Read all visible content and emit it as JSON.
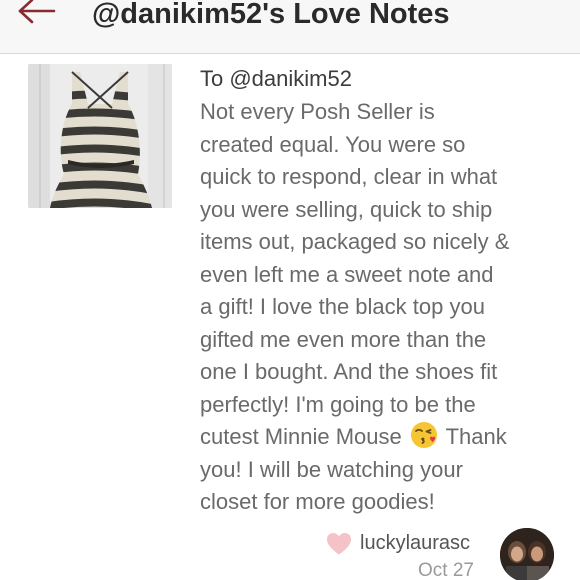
{
  "header": {
    "title": "@danikim52's Love Notes",
    "back_icon": "back-arrow-icon",
    "accent_color": "#8b2a2e"
  },
  "note": {
    "thumbnail": "striped-top-listing-photo",
    "recipient": "To @danikim52",
    "message_lines": [
      "Not every Posh Seller is",
      "created equal. You were so",
      "quick to respond, clear in what",
      "you were selling, quick to ship",
      "items out, packaged so nicely &",
      "even left me a sweet note and",
      "a gift! I love the black top you",
      "gifted me even more than the",
      "one I bought. And the shoes fit",
      "perfectly! I'm going to be the"
    ],
    "line11_before": "cutest Minnie Mouse",
    "line11_emoji": "kissing-face-emoji",
    "line11_after": "Thank",
    "message_tail": [
      "you! I will be watching your",
      "closet for more goodies!"
    ],
    "author": "luckylaurasc",
    "date": "Oct 27",
    "like_icon": "heart-icon",
    "like_color": "#f5c2c7",
    "avatar": "author-avatar"
  }
}
